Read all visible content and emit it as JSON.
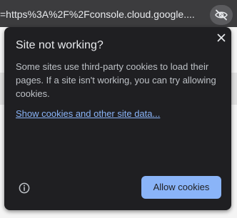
{
  "address_bar": {
    "url_text": "=https%3A%2F%2Fconsole.cloud.google....",
    "tracking_icon": "eye-slash-icon"
  },
  "popup": {
    "title": "Site not working?",
    "description": "Some sites use third-party cookies to load their pages. If a site isn't working, you can try allowing cookies.",
    "link_text": "Show cookies and other site data...",
    "allow_button_label": "Allow cookies",
    "close_icon": "close-icon",
    "info_icon": "info-icon"
  },
  "colors": {
    "popup_background": "#1f1f22",
    "accent": "#8ab4f8",
    "topbar": "#3c3c3e"
  }
}
